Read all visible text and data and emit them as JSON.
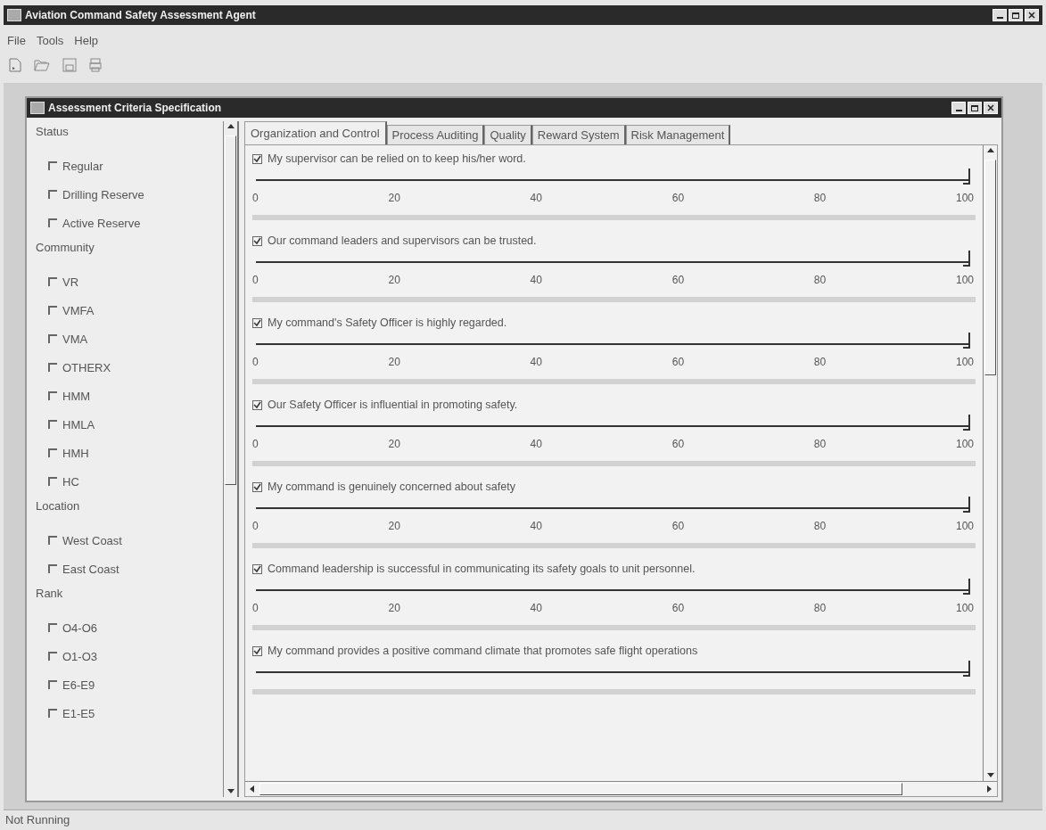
{
  "window": {
    "title": "Aviation Command Safety Assessment Agent"
  },
  "menu": [
    "File",
    "Tools",
    "Help"
  ],
  "status_bar": "Not Running",
  "inner_window": {
    "title": "Assessment Criteria Specification"
  },
  "filters": [
    {
      "heading": "Status",
      "options": [
        {
          "label": "Regular",
          "checked": false
        },
        {
          "label": "Drilling Reserve",
          "checked": false
        },
        {
          "label": "Active Reserve",
          "checked": false
        }
      ]
    },
    {
      "heading": "Community",
      "options": [
        {
          "label": "VR",
          "checked": false
        },
        {
          "label": "VMFA",
          "checked": false
        },
        {
          "label": "VMA",
          "checked": false
        },
        {
          "label": "OTHERX",
          "checked": false
        },
        {
          "label": "HMM",
          "checked": false
        },
        {
          "label": "HMLA",
          "checked": false
        },
        {
          "label": "HMH",
          "checked": false
        },
        {
          "label": "HC",
          "checked": false
        }
      ]
    },
    {
      "heading": "Location",
      "options": [
        {
          "label": "West Coast",
          "checked": false
        },
        {
          "label": "East Coast",
          "checked": false
        }
      ]
    },
    {
      "heading": "Rank",
      "options": [
        {
          "label": "O4-O6",
          "checked": false
        },
        {
          "label": "O1-O3",
          "checked": false
        },
        {
          "label": "E6-E9",
          "checked": false
        },
        {
          "label": "E1-E5",
          "checked": false
        }
      ]
    }
  ],
  "tabs": [
    {
      "label": "Organization and Control",
      "selected": true
    },
    {
      "label": "Process Auditing",
      "selected": false
    },
    {
      "label": "Quality",
      "selected": false
    },
    {
      "label": "Reward System",
      "selected": false
    },
    {
      "label": "Risk Management",
      "selected": false
    }
  ],
  "questions": [
    {
      "text": "My supervisor can be relied on to keep his/her word.",
      "checked": true,
      "level": 1,
      "ticks": [
        "0",
        "20",
        "40",
        "60",
        "80",
        "100"
      ]
    },
    {
      "text": "Our command leaders and supervisors can be trusted.",
      "checked": true,
      "level": 1,
      "ticks": [
        "0",
        "20",
        "40",
        "60",
        "80",
        "100"
      ]
    },
    {
      "text": "My command's Safety Officer is highly regarded.",
      "checked": true,
      "level": 1,
      "ticks": [
        "0",
        "20",
        "40",
        "60",
        "80",
        "100"
      ]
    },
    {
      "text": "Our Safety Officer is influential in promoting safety.",
      "checked": true,
      "level": 1,
      "ticks": [
        "0",
        "20",
        "40",
        "60",
        "80",
        "100"
      ]
    },
    {
      "text": "My command is genuinely concerned about safety",
      "checked": true,
      "level": 1,
      "ticks": [
        "0",
        "20",
        "40",
        "60",
        "80",
        "100"
      ]
    },
    {
      "text": "Command leadership is successful in communicating its safety goals to unit personnel.",
      "checked": true,
      "level": 1,
      "ticks": [
        "0",
        "20",
        "40",
        "60",
        "80",
        "100"
      ]
    },
    {
      "text": "My command provides a positive command climate that promotes safe flight operations",
      "checked": true,
      "level": 1
    }
  ]
}
